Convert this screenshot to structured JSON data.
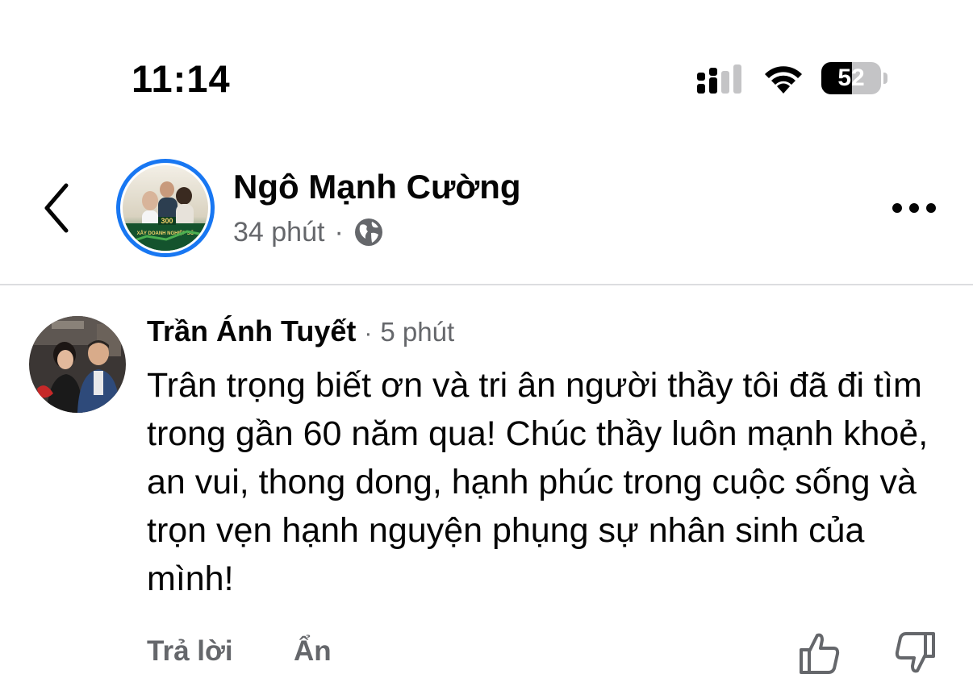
{
  "status_bar": {
    "time": "11:14",
    "battery_level": "52",
    "battery_fraction": 0.52
  },
  "post": {
    "author": "Ngô Mạnh Cường",
    "time_ago": "34 phút",
    "separator": "·",
    "privacy_icon": "globe-icon",
    "avatar_badge": "300",
    "avatar_caption": "XÂY DOANH NGHIỆP SỐ"
  },
  "comment": {
    "author": "Trần Ánh Tuyết",
    "separator": "·",
    "time_ago": "5 phút",
    "text": "Trân trọng biết ơn và tri ân người thầy tôi đã đi tìm trong gần 60 năm qua! Chúc thầy luôn mạnh khoẻ, an vui, thong dong, hạnh phúc trong cuộc sống và trọn vẹn hạnh nguyện phụng sự nhân sinh của mình!",
    "reply_label": "Trả lời",
    "hide_label": "Ẩn"
  },
  "colors": {
    "accent": "#1877f2",
    "secondary_text": "#65676b",
    "primary_text": "#050505",
    "divider": "#dcdde0"
  }
}
